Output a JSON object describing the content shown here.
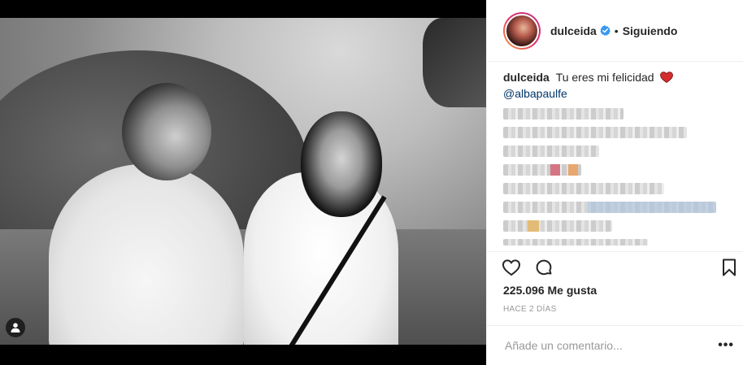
{
  "post": {
    "photo_alt": "black-and-white wedding photo",
    "user_tag_icon": "person-icon"
  },
  "header": {
    "username": "dulceida",
    "verified_icon": "verified-badge-icon",
    "separator": "•",
    "follow_status": "Siguiendo"
  },
  "caption": {
    "username": "dulceida",
    "text": "Tu eres mi felicidad",
    "emoji_icon": "red-heart-icon",
    "mention": "@albapaulfe"
  },
  "actions": {
    "like_icon": "heart-outline-icon",
    "comment_icon": "comment-bubble-icon",
    "save_icon": "bookmark-icon"
  },
  "likes": "225.096 Me gusta",
  "timestamp": "HACE 2 DÍAS",
  "comment_box": {
    "placeholder": "Añade un comentario...",
    "more_label": "•••"
  },
  "colors": {
    "text": "#262626",
    "muted": "#999999",
    "link": "#003569",
    "verified": "#3897f0",
    "border": "#efefef"
  }
}
